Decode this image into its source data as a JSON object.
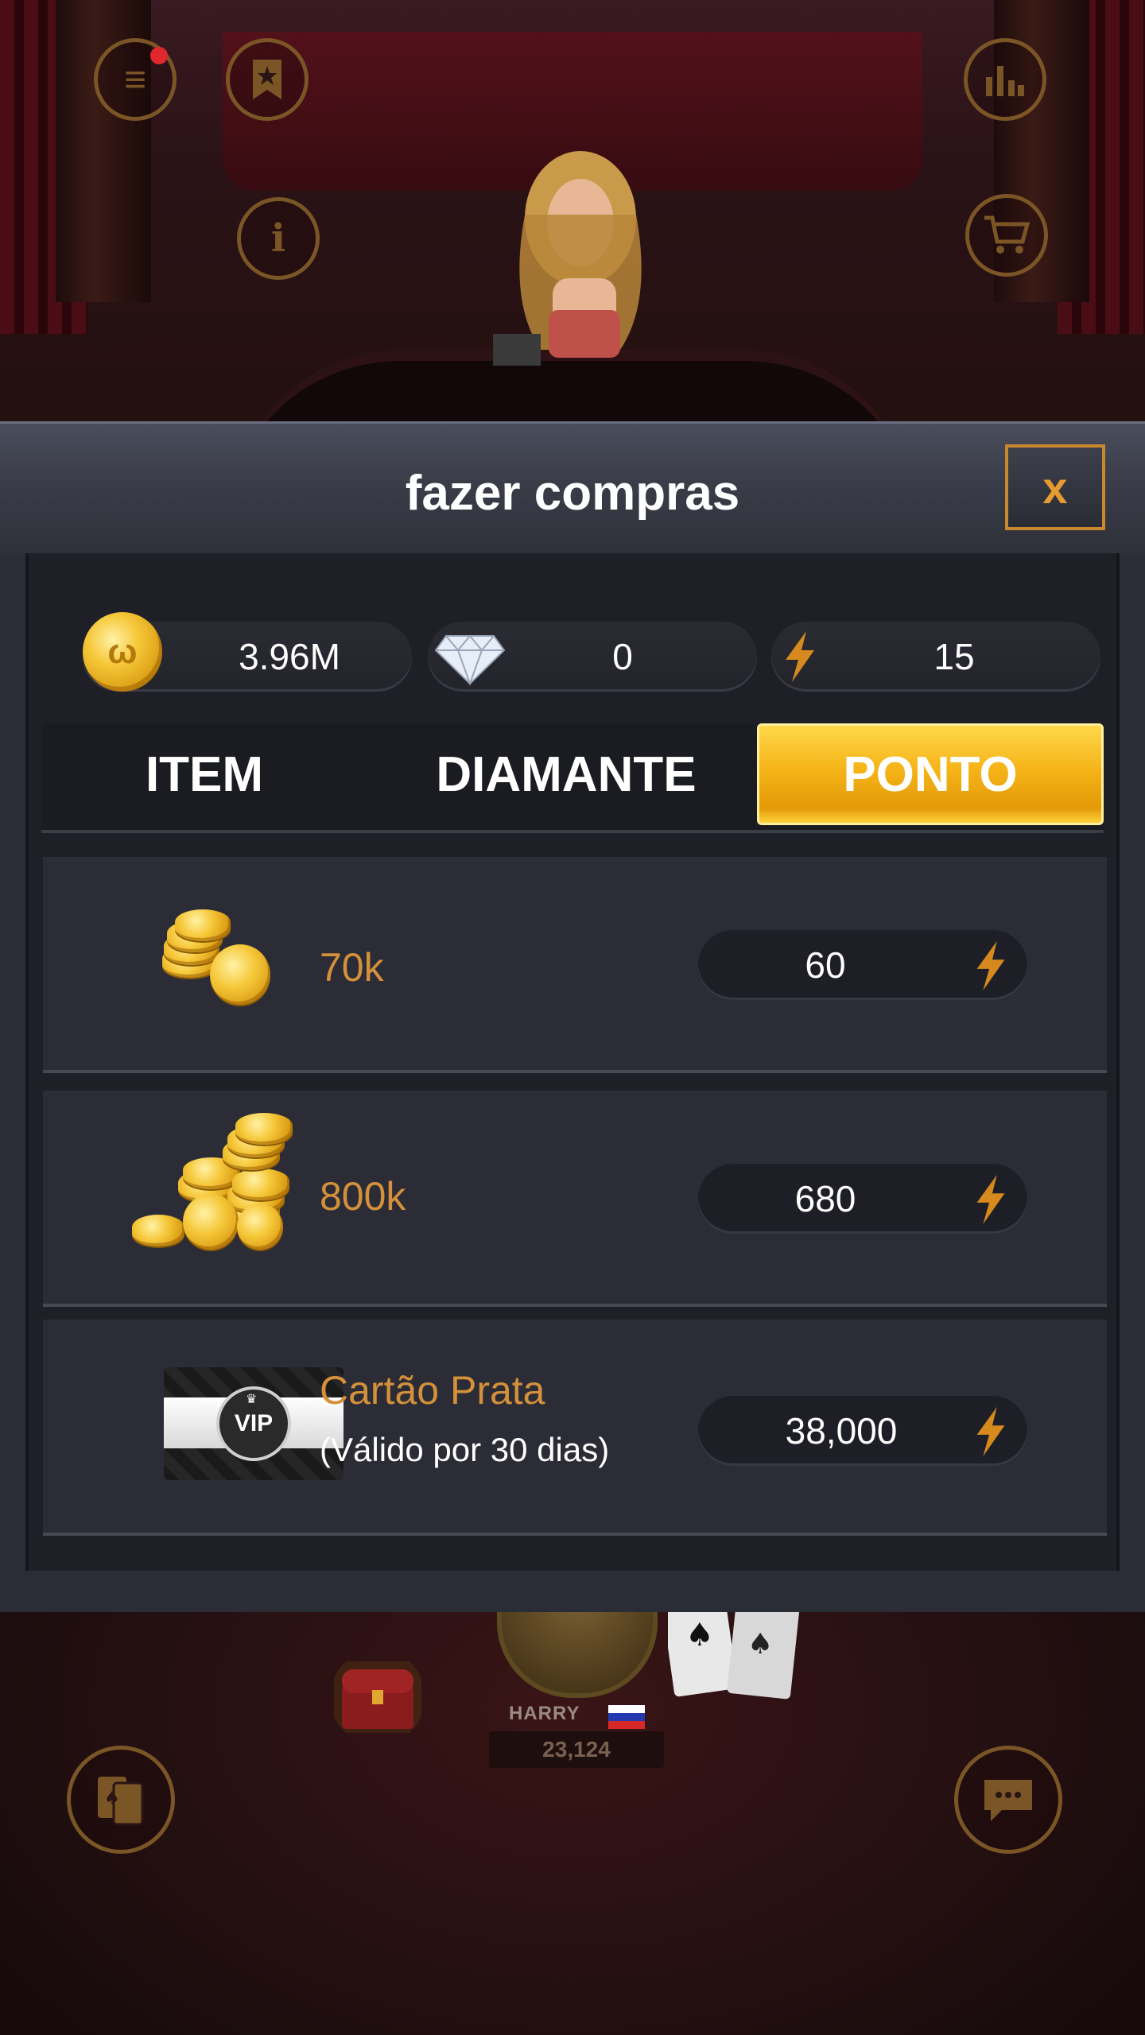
{
  "modal": {
    "title": "fazer compras",
    "close_label": "x"
  },
  "currencies": {
    "coins": "3.96M",
    "diamonds": "0",
    "points": "15"
  },
  "tabs": [
    {
      "label": "ITEM",
      "active": false
    },
    {
      "label": "DIAMANTE",
      "active": false
    },
    {
      "label": "PONTO",
      "active": true
    }
  ],
  "items": [
    {
      "title": "70k",
      "subtitle": "",
      "price": "60",
      "icon": "coin-stack-small-icon"
    },
    {
      "title": "800k",
      "subtitle": "",
      "price": "680",
      "icon": "coin-pile-large-icon"
    },
    {
      "title": "Cartão Prata",
      "subtitle": "(Válido por 30 dias)",
      "price": "38,000",
      "icon": "vip-card-icon"
    }
  ],
  "vip_label": "VIP",
  "player": {
    "name": "HARRY",
    "chips": "23,124"
  },
  "colors": {
    "accent_gold": "#e59b2f",
    "item_title": "#d4903a",
    "active_tab": "#f5b418",
    "modal_bg": "#2b2d36"
  }
}
